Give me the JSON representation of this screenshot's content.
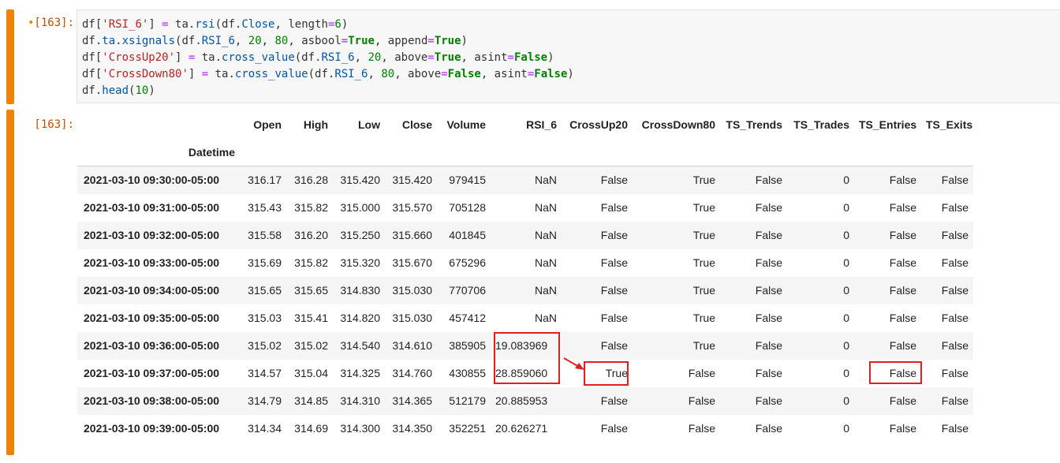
{
  "cell_input": {
    "prompt": "[163]:",
    "code": {
      "line1": [
        "df[",
        "'RSI_6'",
        "] ",
        "=",
        " ta.",
        "rsi",
        "(df.",
        "Close",
        ", length",
        "=",
        "6",
        ")"
      ],
      "line2": [
        "df.",
        "ta",
        ".",
        "xsignals",
        "(df.",
        "RSI_6",
        ", ",
        "20",
        ", ",
        "80",
        ", asbool",
        "=",
        "True",
        ", append",
        "=",
        "True",
        ")"
      ],
      "line3": [
        "df[",
        "'CrossUp20'",
        "] ",
        "=",
        " ta.",
        "cross_value",
        "(df.",
        "RSI_6",
        ", ",
        "20",
        ", above",
        "=",
        "True",
        ", asint",
        "=",
        "False",
        ")"
      ],
      "line4": [
        "df[",
        "'CrossDown80'",
        "] ",
        "=",
        " ta.",
        "cross_value",
        "(df.",
        "RSI_6",
        ", ",
        "80",
        ", above",
        "=",
        "False",
        ", asint",
        "=",
        "False",
        ")"
      ],
      "line5": [
        "df.",
        "head",
        "(",
        "10",
        ")"
      ]
    }
  },
  "cell_output": {
    "prompt": "[163]:",
    "index_name": "Datetime",
    "columns": [
      "Open",
      "High",
      "Low",
      "Close",
      "Volume",
      "RSI_6",
      "CrossUp20",
      "CrossDown80",
      "TS_Trends",
      "TS_Trades",
      "TS_Entries",
      "TS_Exits"
    ],
    "rows": [
      {
        "index": "2021-03-10 09:30:00-05:00",
        "cells": [
          "316.17",
          "316.28",
          "315.420",
          "315.420",
          "979415",
          "NaN",
          "False",
          "True",
          "False",
          "0",
          "False",
          "False"
        ]
      },
      {
        "index": "2021-03-10 09:31:00-05:00",
        "cells": [
          "315.43",
          "315.82",
          "315.000",
          "315.570",
          "705128",
          "NaN",
          "False",
          "True",
          "False",
          "0",
          "False",
          "False"
        ]
      },
      {
        "index": "2021-03-10 09:32:00-05:00",
        "cells": [
          "315.58",
          "316.20",
          "315.250",
          "315.660",
          "401845",
          "NaN",
          "False",
          "True",
          "False",
          "0",
          "False",
          "False"
        ]
      },
      {
        "index": "2021-03-10 09:33:00-05:00",
        "cells": [
          "315.69",
          "315.82",
          "315.320",
          "315.670",
          "675296",
          "NaN",
          "False",
          "True",
          "False",
          "0",
          "False",
          "False"
        ]
      },
      {
        "index": "2021-03-10 09:34:00-05:00",
        "cells": [
          "315.65",
          "315.65",
          "314.830",
          "315.030",
          "770706",
          "NaN",
          "False",
          "True",
          "False",
          "0",
          "False",
          "False"
        ]
      },
      {
        "index": "2021-03-10 09:35:00-05:00",
        "cells": [
          "315.03",
          "315.41",
          "314.820",
          "315.030",
          "457412",
          "NaN",
          "False",
          "True",
          "False",
          "0",
          "False",
          "False"
        ]
      },
      {
        "index": "2021-03-10 09:36:00-05:00",
        "cells": [
          "315.02",
          "315.02",
          "314.540",
          "314.610",
          "385905",
          "19.083969",
          "False",
          "True",
          "False",
          "0",
          "False",
          "False"
        ]
      },
      {
        "index": "2021-03-10 09:37:00-05:00",
        "cells": [
          "314.57",
          "315.04",
          "314.325",
          "314.760",
          "430855",
          "28.859060",
          "True",
          "False",
          "False",
          "0",
          "False",
          "False"
        ]
      },
      {
        "index": "2021-03-10 09:38:00-05:00",
        "cells": [
          "314.79",
          "314.85",
          "314.310",
          "314.365",
          "512179",
          "20.885953",
          "False",
          "False",
          "False",
          "0",
          "False",
          "False"
        ]
      },
      {
        "index": "2021-03-10 09:39:00-05:00",
        "cells": [
          "314.34",
          "314.69",
          "314.300",
          "314.350",
          "352251",
          "20.626271",
          "False",
          "False",
          "False",
          "0",
          "False",
          "False"
        ]
      }
    ]
  },
  "colors": {
    "cell_bar": "#f0820a",
    "prompt": "#c24f00",
    "highlight": "#e02020"
  },
  "annotations": {
    "highlighted_cells": [
      "RSI_6 rows 09:36-09:37",
      "CrossUp20 row 09:37",
      "TS_Entries row 09:37"
    ],
    "arrow": "arrow-icon"
  }
}
